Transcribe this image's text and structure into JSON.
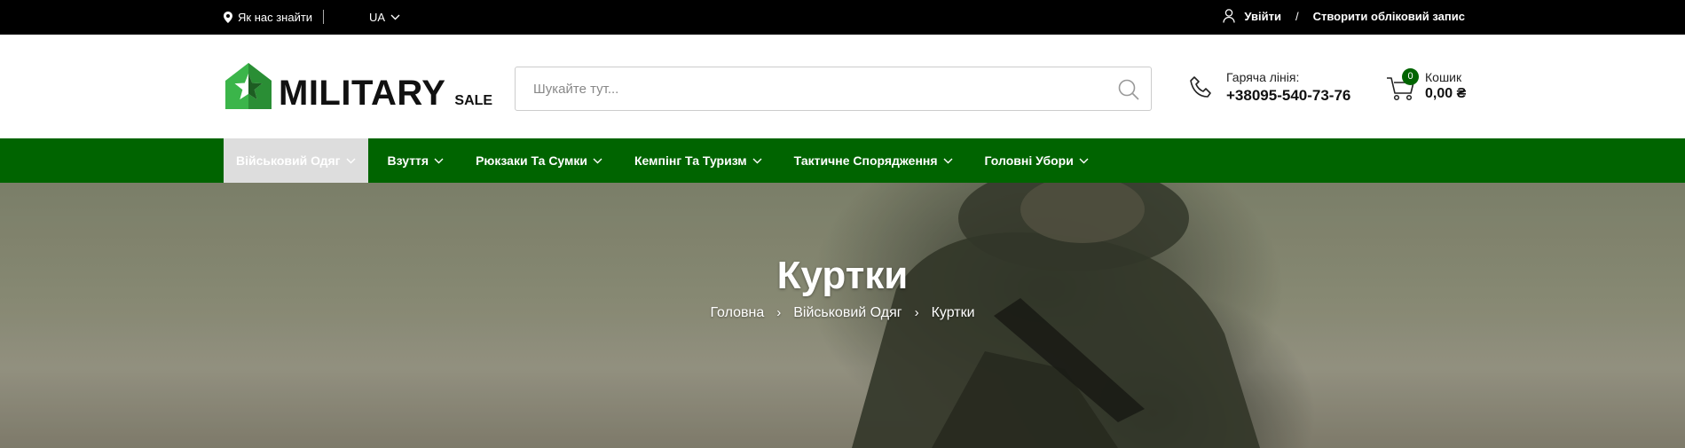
{
  "topbar": {
    "location_label": "Як нас знайти",
    "language": "UA",
    "login_label": "Увійти",
    "separator": "/",
    "register_label": "Створити обліковий запис"
  },
  "header": {
    "logo_text": "MILITARY",
    "logo_sub": "SALE",
    "search_placeholder": "Шукайте тут...",
    "hotline_label": "Гаряча лінія:",
    "hotline_number": "+38095-540-73-76",
    "cart_label": "Кошик",
    "cart_count": "0",
    "cart_total": "0,00 ₴"
  },
  "nav": {
    "items": [
      {
        "label": "Військовий Одяг"
      },
      {
        "label": "Взуття"
      },
      {
        "label": "Рюкзаки Та Сумки"
      },
      {
        "label": "Кемпінг Та Туризм"
      },
      {
        "label": "Тактичне Спорядження"
      },
      {
        "label": "Головні Убори"
      }
    ]
  },
  "hero": {
    "title": "Куртки",
    "breadcrumb": [
      "Головна",
      "Військовий Одяг",
      "Куртки"
    ]
  },
  "colors": {
    "brand_green": "#006400",
    "logo_green": "#3bb54a",
    "topbar_bg": "#000000"
  }
}
